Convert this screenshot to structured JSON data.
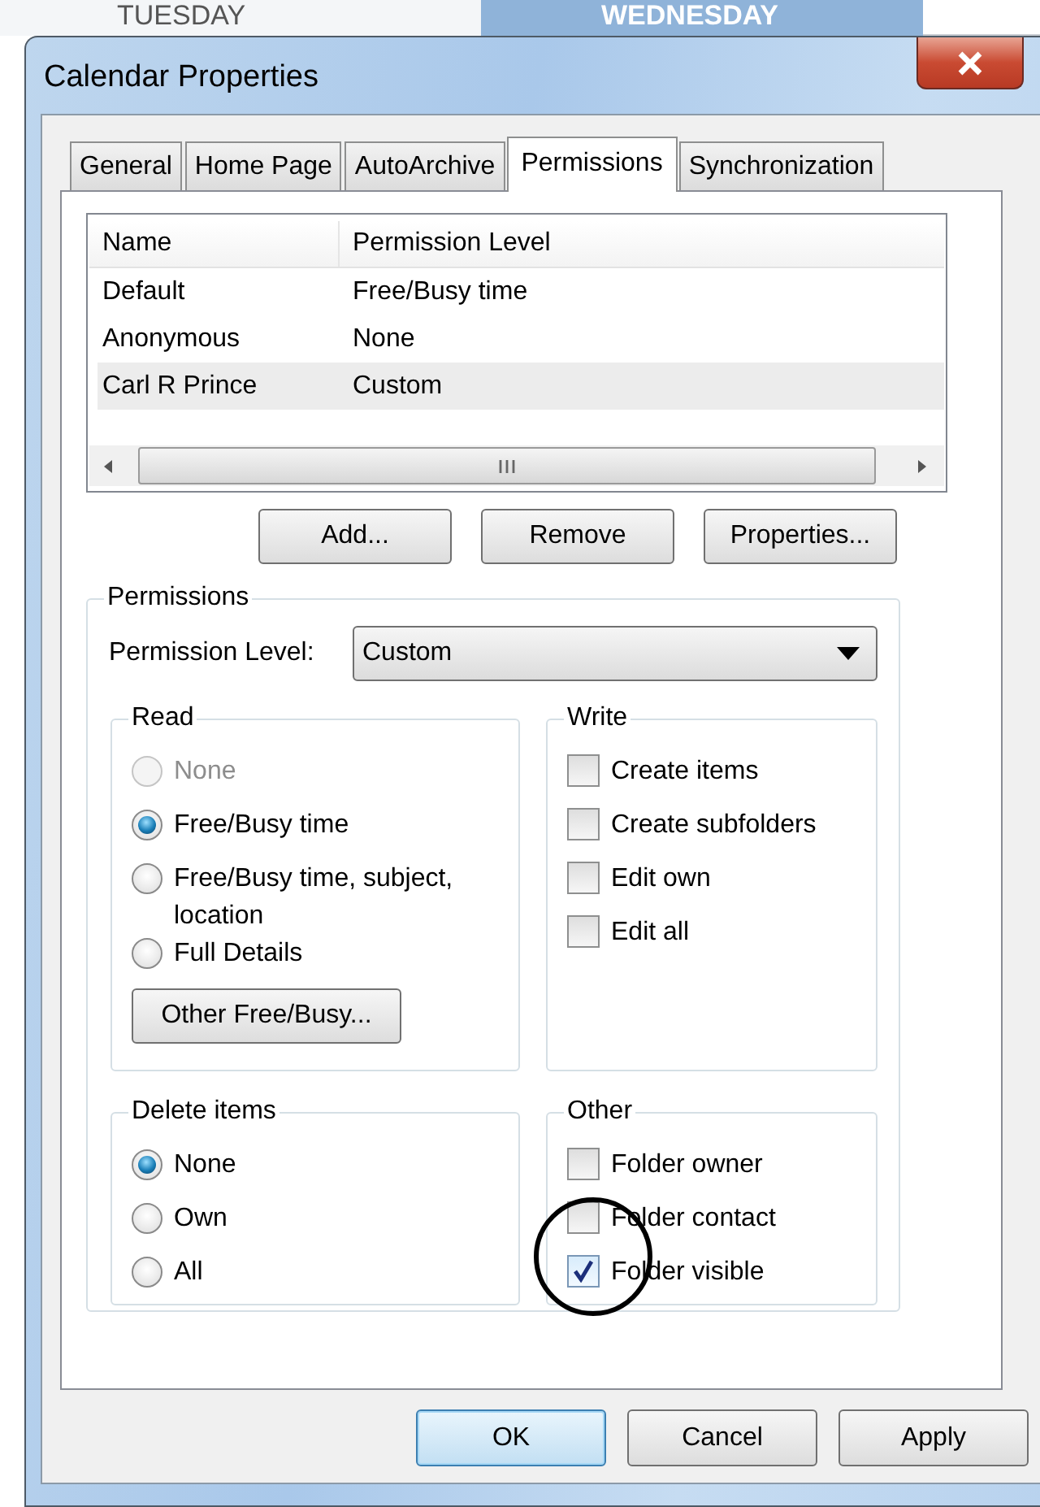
{
  "background": {
    "day_headers": [
      {
        "label": "TUESDAY",
        "selected": false
      },
      {
        "label": "WEDNESDAY",
        "selected": true
      }
    ]
  },
  "window": {
    "title": "Calendar Properties"
  },
  "tabs": [
    {
      "label": "General",
      "selected": false
    },
    {
      "label": "Home Page",
      "selected": false
    },
    {
      "label": "AutoArchive",
      "selected": false
    },
    {
      "label": "Permissions",
      "selected": true
    },
    {
      "label": "Synchronization",
      "selected": false
    }
  ],
  "permissions_list": {
    "columns": [
      "Name",
      "Permission Level"
    ],
    "rows": [
      {
        "name": "Default",
        "permission_level": "Free/Busy time",
        "selected": false
      },
      {
        "name": "Anonymous",
        "permission_level": "None",
        "selected": false
      },
      {
        "name": "Carl R Prince",
        "permission_level": "Custom",
        "selected": true
      }
    ]
  },
  "list_buttons": [
    "Add...",
    "Remove",
    "Properties..."
  ],
  "permissions": {
    "title": "Permissions",
    "level_label": "Permission Level:",
    "level_value": "Custom",
    "read": {
      "title": "Read",
      "options": [
        {
          "label": "None",
          "selected": false,
          "disabled": true
        },
        {
          "label": "Free/Busy time",
          "selected": true,
          "disabled": false
        },
        {
          "label": "Free/Busy time, subject, location",
          "selected": false,
          "disabled": false
        },
        {
          "label": "Full Details",
          "selected": false,
          "disabled": false
        }
      ],
      "button": "Other Free/Busy..."
    },
    "write": {
      "title": "Write",
      "options": [
        {
          "label": "Create items",
          "checked": false
        },
        {
          "label": "Create subfolders",
          "checked": false
        },
        {
          "label": "Edit own",
          "checked": false
        },
        {
          "label": "Edit all",
          "checked": false
        }
      ]
    },
    "delete_items": {
      "title": "Delete items",
      "options": [
        {
          "label": "None",
          "selected": true
        },
        {
          "label": "Own",
          "selected": false
        },
        {
          "label": "All",
          "selected": false
        }
      ]
    },
    "other": {
      "title": "Other",
      "options": [
        {
          "label": "Folder owner",
          "checked": false,
          "circled": false
        },
        {
          "label": "Folder contact",
          "checked": false,
          "circled": false
        },
        {
          "label": "Folder visible",
          "checked": true,
          "circled": true
        }
      ]
    }
  },
  "footer_buttons": [
    {
      "label": "OK",
      "default": true
    },
    {
      "label": "Cancel",
      "default": false
    },
    {
      "label": "Apply",
      "default": false
    }
  ]
}
